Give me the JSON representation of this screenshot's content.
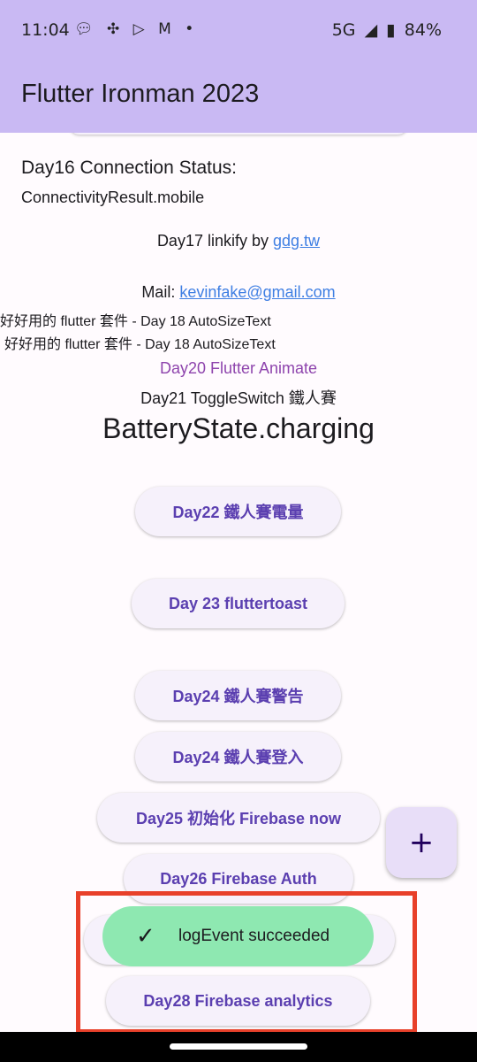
{
  "status_bar": {
    "time": "11:04",
    "notification_icons": [
      "chat-bubble-icon",
      "fan-icon",
      "play-store-icon",
      "gmail-icon",
      "more-dot-icon"
    ],
    "network": "5G",
    "battery": "84%"
  },
  "app_bar": {
    "title": "Flutter Ironman 2023"
  },
  "content": {
    "day16_title": "Day16 Connection Status:",
    "day16_value": "ConnectivityResult.mobile",
    "linkify_prefix": "Day17 linkify by ",
    "linkify_link": "gdg.tw",
    "mail_prefix": "Mail: ",
    "mail_link": "kevinfake@gmail.com",
    "autosize_1": "好好用的 flutter 套件 - Day 18 AutoSizeText",
    "autosize_2": "好好用的 flutter 套件 - Day 18 AutoSizeText",
    "animate": "Day20 Flutter Animate",
    "toggle_switch": "Day21 ToggleSwitch 鐵人賽",
    "battery_state": "BatteryState.charging"
  },
  "buttons": {
    "day22": "Day22 鐵人賽電量",
    "day23": "Day 23 fluttertoast",
    "day24_warning": "Day24 鐵人賽警告",
    "day24_login": "Day24 鐵人賽登入",
    "day25": "Day25 初始化 Firebase now",
    "day26": "Day26 Firebase Auth",
    "day28": "Day28 Firebase analytics"
  },
  "toast": {
    "message": "logEvent succeeded"
  },
  "fab": {
    "label": "+"
  },
  "colors": {
    "app_bar": "#c9b9f3",
    "button_text": "#5b3fb0",
    "toast_bg": "#8ee8b1",
    "highlight": "#e8402a",
    "link": "#3f7fe3"
  }
}
